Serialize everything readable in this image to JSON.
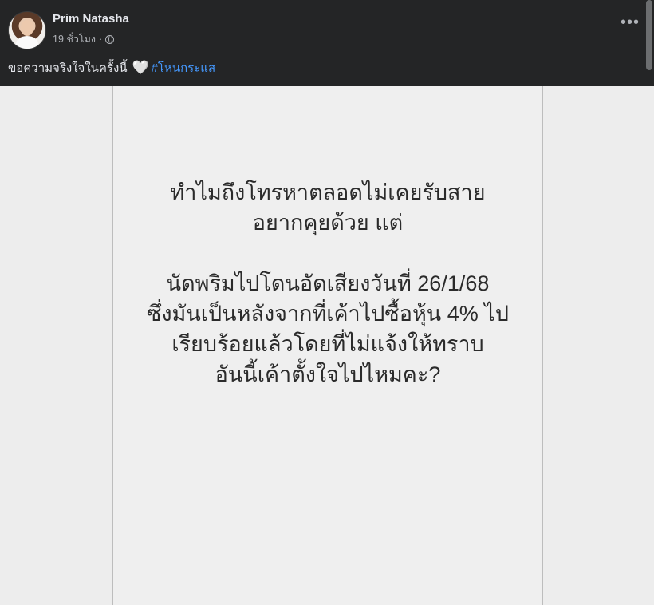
{
  "post": {
    "author": "Prim Natasha",
    "time": "19 ชั่วโมง",
    "separator": "·",
    "caption_text": "ขอความจริงใจในครั้งนี้",
    "caption_emoji": "🤍",
    "hashtag": "#โหนกระแส",
    "more_label": "•••"
  },
  "image_text": {
    "line1": "ทำไมถึงโทรหาตลอดไม่เคยรับสาย",
    "line2": "อยากคุยด้วย แต่",
    "line3": "นัดพริมไปโดนอัดเสียงวันที่ 26/1/68",
    "line4": "ซึ่งมันเป็นหลังจากที่เค้าไปซื้อหุ้น 4% ไป",
    "line5": "เรียบร้อยแล้วโดยที่ไม่แจ้งให้ทราบ",
    "line6": "อันนี้เค้าตั้งใจไปไหมคะ?"
  },
  "icons": {
    "privacy": "globe-icon",
    "emoji": "heart-icon",
    "menu": "more-icon"
  },
  "colors": {
    "header_bg": "#242526",
    "primary_text": "#e4e6eb",
    "secondary_text": "#b0b3b8",
    "hashtag": "#4599ff",
    "card_bg": "#efefef"
  }
}
